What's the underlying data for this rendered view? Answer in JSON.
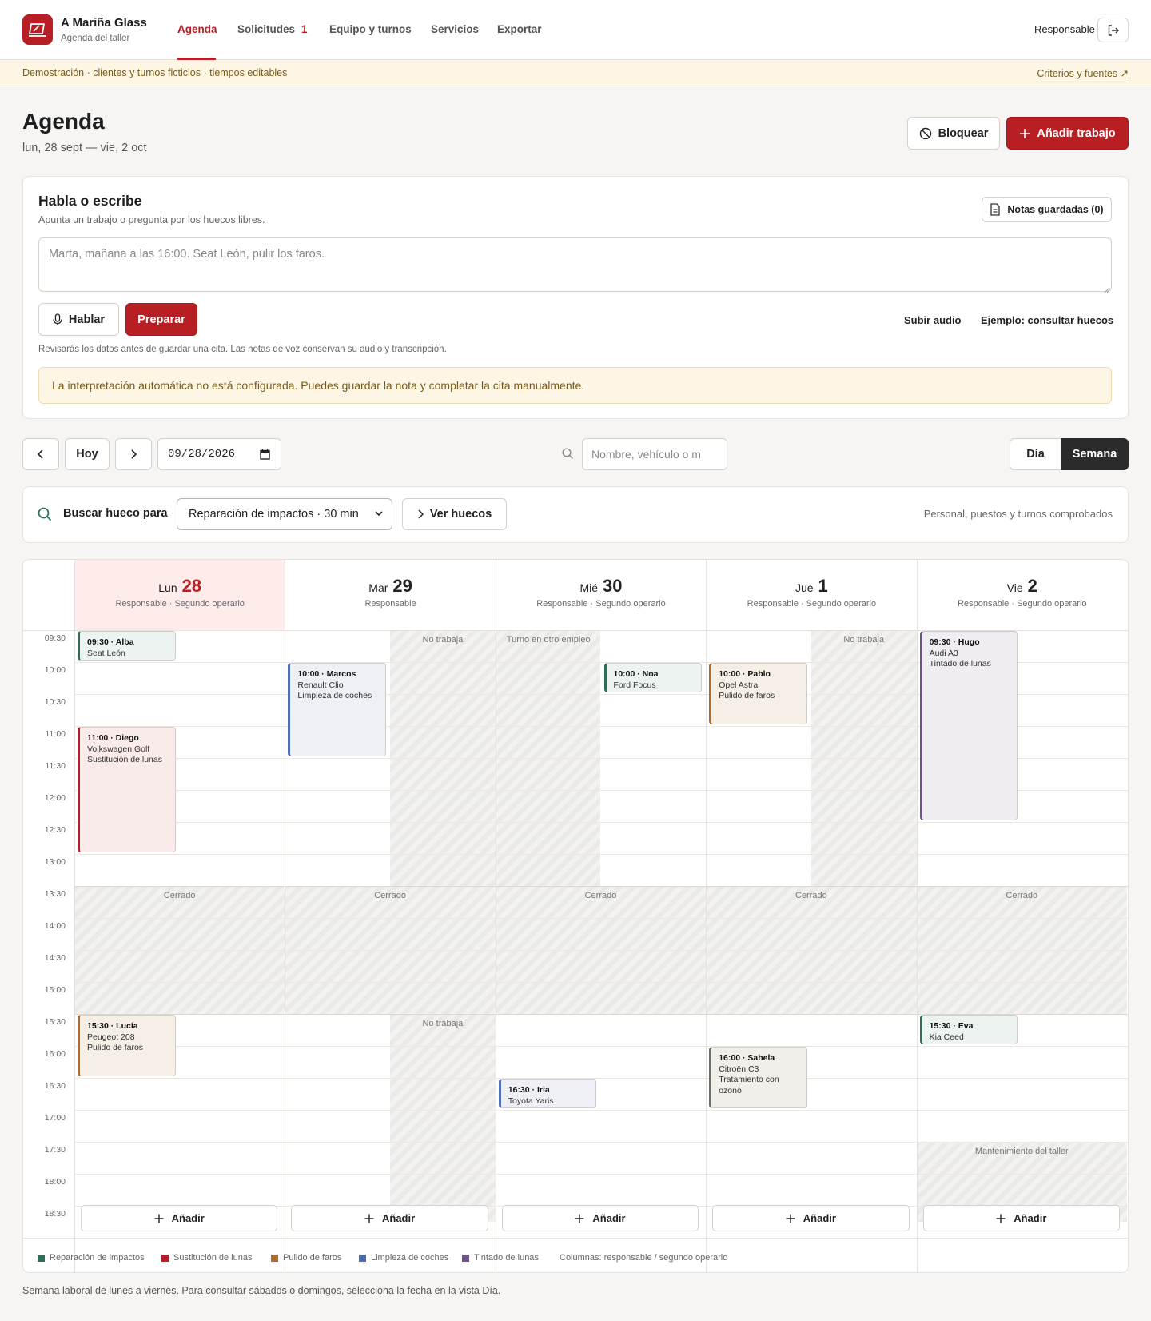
{
  "app": {
    "name": "A Mariña Glass",
    "subtitle": "Agenda del taller"
  },
  "nav": {
    "agenda": "Agenda",
    "solicitudes": "Solicitudes",
    "solicitudes_count": "1",
    "equipo": "Equipo y turnos",
    "servicios": "Servicios",
    "exportar": "Exportar"
  },
  "user": {
    "role": "Responsable"
  },
  "demo": {
    "text": "Demostración · clientes y turnos ficticios · tiempos editables",
    "link": "Criterios y fuentes ↗"
  },
  "page": {
    "title": "Agenda",
    "range": "lun, 28 sept — vie, 2 oct",
    "block_label": "Bloquear",
    "add_job_label": "Añadir trabajo"
  },
  "voice": {
    "title": "Habla o escribe",
    "subtitle": "Apunta un trabajo o pregunta por los huecos libres.",
    "notes_label": "Notas guardadas (0)",
    "placeholder": "Marta, mañana a las 16:00. Seat León, pulir los faros.",
    "speak_label": "Hablar",
    "prepare_label": "Preparar",
    "upload_label": "Subir audio",
    "example_label": "Ejemplo: consultar huecos",
    "hint": "Revisarás los datos antes de guardar una cita. Las notas de voz conservan su audio y transcripción.",
    "warning": "La interpretación automática no está configurada. Puedes guardar la nota y completar la cita manualmente."
  },
  "toolbar": {
    "today_label": "Hoy",
    "date_value": "09/28/2026",
    "search_placeholder": "Nombre, vehículo o m",
    "view_day": "Día",
    "view_week": "Semana"
  },
  "slot_search": {
    "label": "Buscar hueco para",
    "selected_service": "Reparación de impactos · 30 min",
    "see_label": "Ver huecos",
    "note": "Personal, puestos y turnos comprobados"
  },
  "calendar": {
    "times": [
      "09:30",
      "10:00",
      "10:30",
      "11:00",
      "11:30",
      "12:00",
      "12:30",
      "13:00",
      "13:30",
      "14:00",
      "14:30",
      "15:00",
      "15:30",
      "16:00",
      "16:30",
      "17:00",
      "17:30",
      "18:00",
      "18:30"
    ],
    "days": [
      {
        "weekday": "Lun",
        "num": "28",
        "staff": "Responsable · Segundo operario",
        "today": true
      },
      {
        "weekday": "Mar",
        "num": "29",
        "staff": "Responsable"
      },
      {
        "weekday": "Mié",
        "num": "30",
        "staff": "Responsable · Segundo operario"
      },
      {
        "weekday": "Jue",
        "num": "1",
        "staff": "Responsable · Segundo operario"
      },
      {
        "weekday": "Vie",
        "num": "2",
        "staff": "Responsable · Segundo operario"
      }
    ],
    "closed_label": "Cerrado",
    "blocks": [
      {
        "day": 1,
        "col": 1,
        "start": "09:30",
        "end": "13:30",
        "label": "No trabaja"
      },
      {
        "day": 1,
        "col": 1,
        "start": "15:30",
        "end": "18:45",
        "label": "No trabaja"
      },
      {
        "day": 2,
        "col": 0,
        "start": "09:30",
        "end": "13:30",
        "label": "Turno en otro empleo"
      },
      {
        "day": 3,
        "col": 1,
        "start": "09:30",
        "end": "13:30",
        "label": "No trabaja"
      },
      {
        "day": 4,
        "col": -1,
        "start": "17:30",
        "end": "18:45",
        "label": "Mantenimiento del taller"
      }
    ],
    "appointments": [
      {
        "day": 0,
        "col": 0,
        "start": "09:30",
        "end": "10:00",
        "title": "09:30 · Alba",
        "vehicle": "Seat León",
        "service": "",
        "type": "reparacion"
      },
      {
        "day": 0,
        "col": 0,
        "start": "11:00",
        "end": "13:00",
        "title": "11:00 · Diego",
        "vehicle": "Volkswagen Golf",
        "service": "Sustitución de lunas",
        "type": "sustitucion"
      },
      {
        "day": 0,
        "col": 0,
        "start": "15:30",
        "end": "16:30",
        "title": "15:30 · Lucía",
        "vehicle": "Peugeot 208",
        "service": "Pulido de faros",
        "type": "pulido"
      },
      {
        "day": 1,
        "col": 0,
        "start": "10:00",
        "end": "11:30",
        "title": "10:00 · Marcos",
        "vehicle": "Renault Clio",
        "service": "Limpieza de coches",
        "type": "limpieza"
      },
      {
        "day": 2,
        "col": 1,
        "start": "10:00",
        "end": "10:30",
        "title": "10:00 · Noa",
        "vehicle": "Ford Focus",
        "service": "",
        "type": "reparacion"
      },
      {
        "day": 2,
        "col": 0,
        "start": "16:30",
        "end": "17:00",
        "title": "16:30 · Iria",
        "vehicle": "Toyota Yaris",
        "service": "",
        "type": "limpieza"
      },
      {
        "day": 3,
        "col": 0,
        "start": "10:00",
        "end": "11:00",
        "title": "10:00 · Pablo",
        "vehicle": "Opel Astra",
        "service": "Pulido de faros",
        "type": "pulido"
      },
      {
        "day": 3,
        "col": 0,
        "start": "16:00",
        "end": "17:00",
        "title": "16:00 · Sabela",
        "vehicle": "Citroën C3",
        "service": "Tratamiento con ozono",
        "type": "ozono"
      },
      {
        "day": 4,
        "col": 0,
        "start": "09:30",
        "end": "12:30",
        "title": "09:30 · Hugo",
        "vehicle": "Audi A3",
        "service": "Tintado de lunas",
        "type": "tintado"
      },
      {
        "day": 4,
        "col": 0,
        "start": "15:30",
        "end": "16:00",
        "title": "15:30 · Eva",
        "vehicle": "Kia Ceed",
        "service": "",
        "type": "reparacion"
      }
    ],
    "add_label": "Añadir"
  },
  "legend": {
    "items": [
      {
        "label": "Reparación de impactos",
        "color": "#2e6e58"
      },
      {
        "label": "Sustitución de lunas",
        "color": "#b81f24"
      },
      {
        "label": "Pulido de faros",
        "color": "#b06a2a"
      },
      {
        "label": "Limpieza de coches",
        "color": "#4d6ab3"
      },
      {
        "label": "Tintado de lunas",
        "color": "#6c5584"
      }
    ],
    "columns_note": "Columnas: responsable / segundo operario"
  },
  "footer": "Semana laboral de lunes a viernes. Para consultar sábados o domingos, selecciona la fecha en la vista Día.",
  "colors": {
    "accent": "#b81f24",
    "dark": "#2b2b2b"
  }
}
